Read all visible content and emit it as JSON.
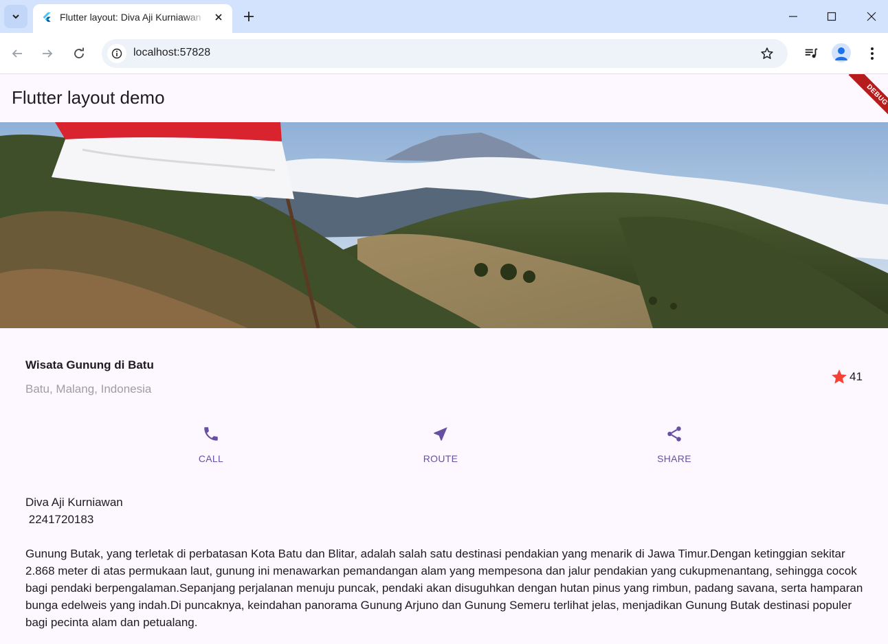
{
  "browser": {
    "tab_title": "Flutter layout: Diva Aji Kurniawan",
    "url": "localhost:57828"
  },
  "app": {
    "title": "Flutter layout demo",
    "debug_label": "DEBUG"
  },
  "place": {
    "name": "Wisata Gunung di Batu",
    "location": "Batu, Malang, Indonesia",
    "rating_count": "41",
    "star_color": "#f44336"
  },
  "actions": [
    {
      "label": "CALL",
      "icon": "phone-icon"
    },
    {
      "label": "ROUTE",
      "icon": "near-me-icon"
    },
    {
      "label": "SHARE",
      "icon": "share-icon"
    }
  ],
  "accent_color": "#6750a4",
  "description": "Diva Aji Kurniawan\n 2241720183\n\nGunung Butak, yang terletak di perbatasan Kota Batu dan Blitar, adalah salah satu destinasi pendakian yang menarik di Jawa Timur.Dengan ketinggian sekitar 2.868 meter di atas permukaan laut, gunung ini menawarkan pemandangan alam yang mempesona dan jalur pendakian yang cukupmenantang, sehingga cocok bagi pendaki berpengalaman.Sepanjang perjalanan menuju puncak, pendaki akan disuguhkan dengan hutan pinus yang rimbun, padang savana, serta hamparan bunga edelweis yang indah.Di puncaknya, keindahan panorama Gunung Arjuno dan Gunung Semeru terlihat jelas, menjadikan Gunung Butak destinasi populer bagi pecinta alam dan petualang."
}
